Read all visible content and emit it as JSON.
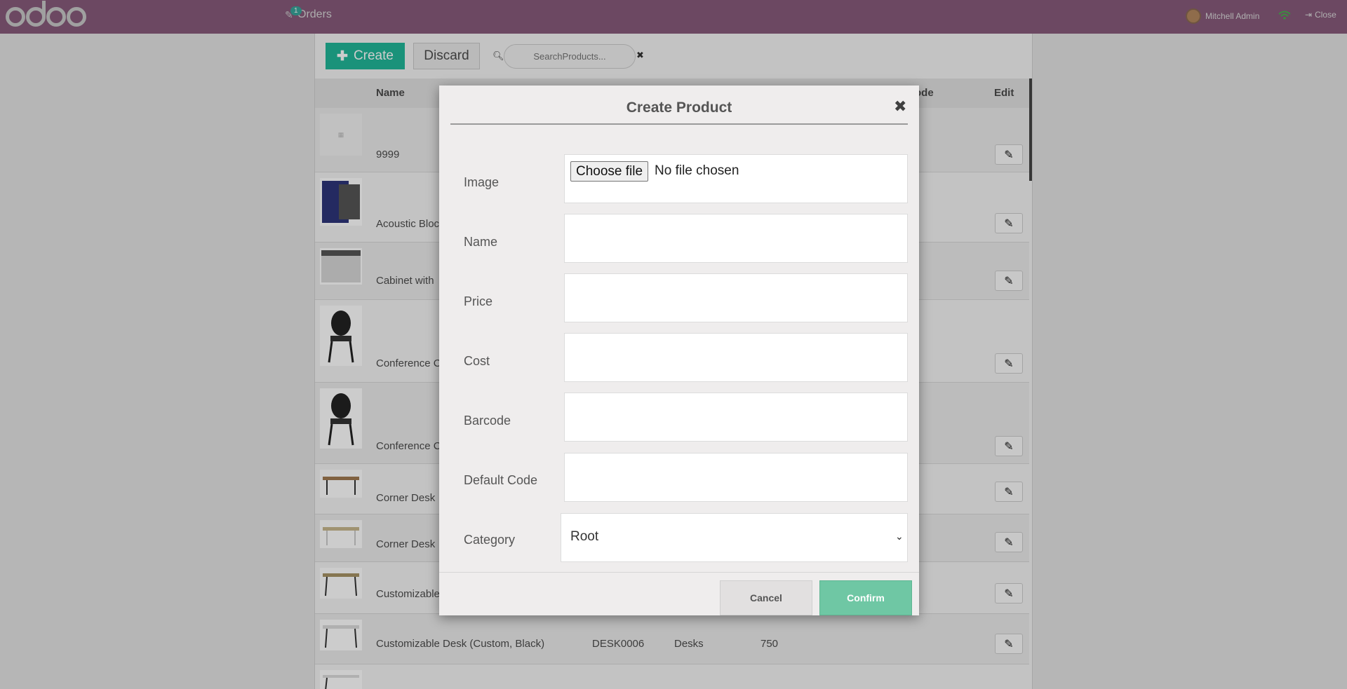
{
  "topbar": {
    "app_name": "Orders",
    "orders_count": "1",
    "user_name": "Mitchell Admin",
    "close_label": "Close"
  },
  "toolbar": {
    "create_label": "Create",
    "discard_label": "Discard",
    "search_placeholder": "SearchProducts..."
  },
  "table": {
    "headers": {
      "name": "Name",
      "code": "ode",
      "edit": "Edit"
    },
    "rows": [
      {
        "name": "9999"
      },
      {
        "name": "Acoustic Bloc"
      },
      {
        "name": "Cabinet with"
      },
      {
        "name": "Conference C"
      },
      {
        "name": "Conference C"
      },
      {
        "name": "Corner Desk"
      },
      {
        "name": "Corner Desk"
      },
      {
        "name": "Customizable"
      },
      {
        "name": "Customizable Desk (Custom, Black)",
        "code": "DESK0006",
        "category": "Desks",
        "price": "750"
      },
      {
        "name": ""
      }
    ]
  },
  "modal": {
    "title": "Create Product",
    "fields": {
      "image_label": "Image",
      "file_button": "Choose file",
      "file_status": "No file chosen",
      "name_label": "Name",
      "price_label": "Price",
      "cost_label": "Cost",
      "barcode_label": "Barcode",
      "default_code_label": "Default Code",
      "category_label": "Category",
      "category_value": "Root"
    },
    "cancel_label": "Cancel",
    "confirm_label": "Confirm"
  }
}
